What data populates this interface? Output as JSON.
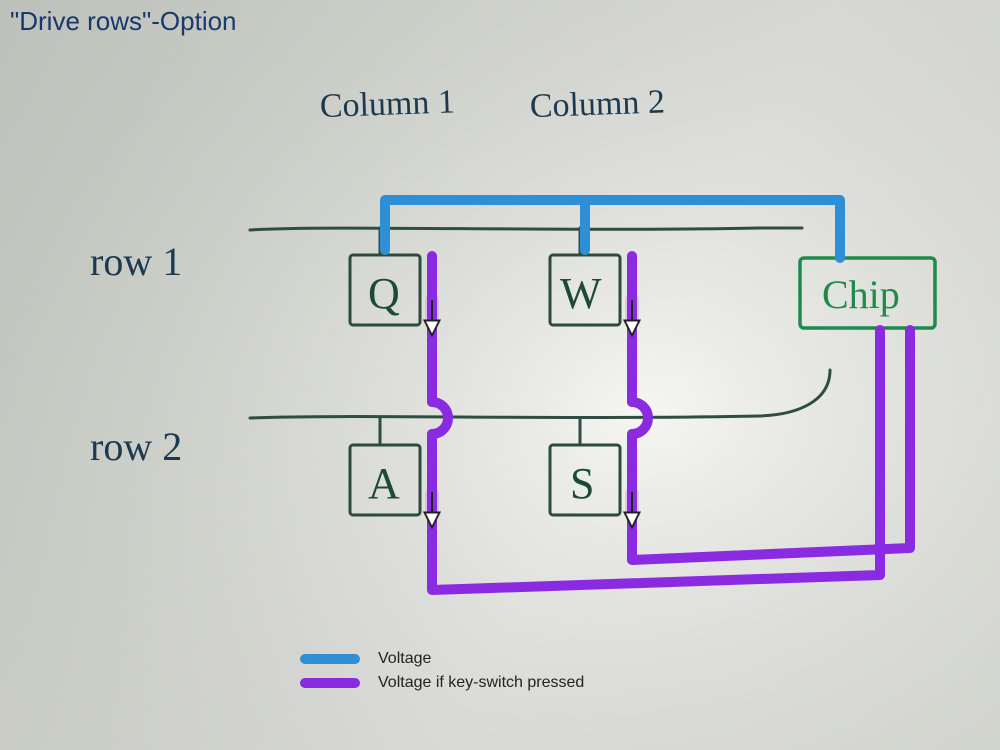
{
  "title": "\"Drive rows\"-Option",
  "columns": {
    "c1": "Column 1",
    "c2": "Column 2"
  },
  "rows": {
    "r1": "row 1",
    "r2": "row 2"
  },
  "keys": {
    "q": "Q",
    "w": "W",
    "a": "A",
    "s": "S"
  },
  "chip": "Chip",
  "legend": {
    "voltage": "Voltage",
    "voltage_pressed": "Voltage if key-switch pressed"
  },
  "colors": {
    "title": "#1b3f7a",
    "voltage": "#2f8fd6",
    "pressed": "#8a2be2",
    "ink": "#2b4b3f",
    "ink_light": "#3e5d53",
    "chip": "#1f8a4c"
  }
}
